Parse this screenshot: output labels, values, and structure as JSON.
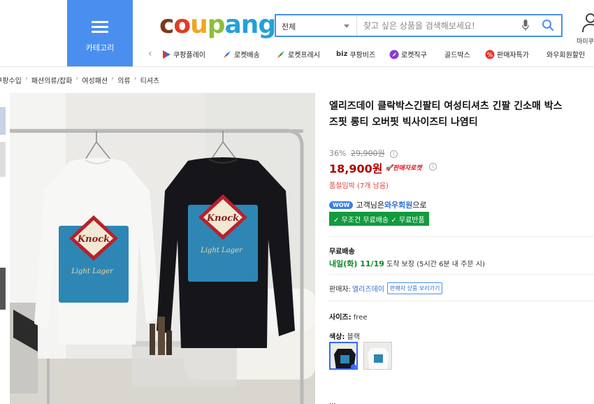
{
  "header": {
    "category_label": "카테고리",
    "search": {
      "category_value": "전체",
      "placeholder": "찾고 싶은 상품을 검색해보세요!"
    },
    "mypage_label": "마이쿠",
    "shortcuts": [
      {
        "label": "쿠팡플레이",
        "icon": "coupang-play-icon"
      },
      {
        "label": "로켓배송",
        "icon": "rocket-icon"
      },
      {
        "label": "로켓프레시",
        "icon": "rocket-fresh-icon"
      },
      {
        "label": "쿠팡비즈",
        "prefix": "biz",
        "icon": "biz-icon"
      },
      {
        "label": "로켓직구",
        "icon": "rocket-direct-icon"
      },
      {
        "label": "골드박스",
        "icon": ""
      },
      {
        "label": "판매자특가",
        "icon": "seller-deal-icon"
      },
      {
        "label": "와우회원할인",
        "icon": ""
      }
    ]
  },
  "breadcrumb": [
    "쿠팡수입",
    "패션의류/잡화",
    "여성패션",
    "의류",
    "티셔츠"
  ],
  "product": {
    "title_line1": "엘리즈데이 클락박스긴팔티 여성티셔츠 긴팔 긴소매 박스",
    "title_line2": "즈핏 롱티 오버핏 빅사이즈티 나염티",
    "discount": "36%",
    "original_price": "29,900원",
    "price": "18,900원",
    "rocket_badge": "판매자로켓",
    "stock_notice": "품절임박 (7개 남음)",
    "wow": {
      "pill": "WOW",
      "pre": "고객님은 ",
      "highlight": "와우회원",
      "post": "으로"
    },
    "free_box": "✓ 무조건 무료배송 ✓ 무료반품",
    "shipping_heading": "무료배송",
    "shipping_date": "내일(화) 11/19",
    "shipping_suffix": " 도착 보장",
    "shipping_note": " (5시간 6분 내 주문 시)",
    "seller_label": "판매자:",
    "seller_name": "엘리즈데이",
    "seller_button": "판매자 상품 보러가기",
    "size_label": "사이즈:",
    "size_value": " free",
    "color_label": "색상:",
    "color_value": " 블랙",
    "print_text": {
      "brand": "Knock",
      "script": "Light Lager"
    }
  },
  "bottom_text": "...",
  "colors": {
    "accent": "#4a8ff0",
    "price": "#ae0000",
    "green": "#139a3e",
    "link": "#2d6fd6"
  }
}
